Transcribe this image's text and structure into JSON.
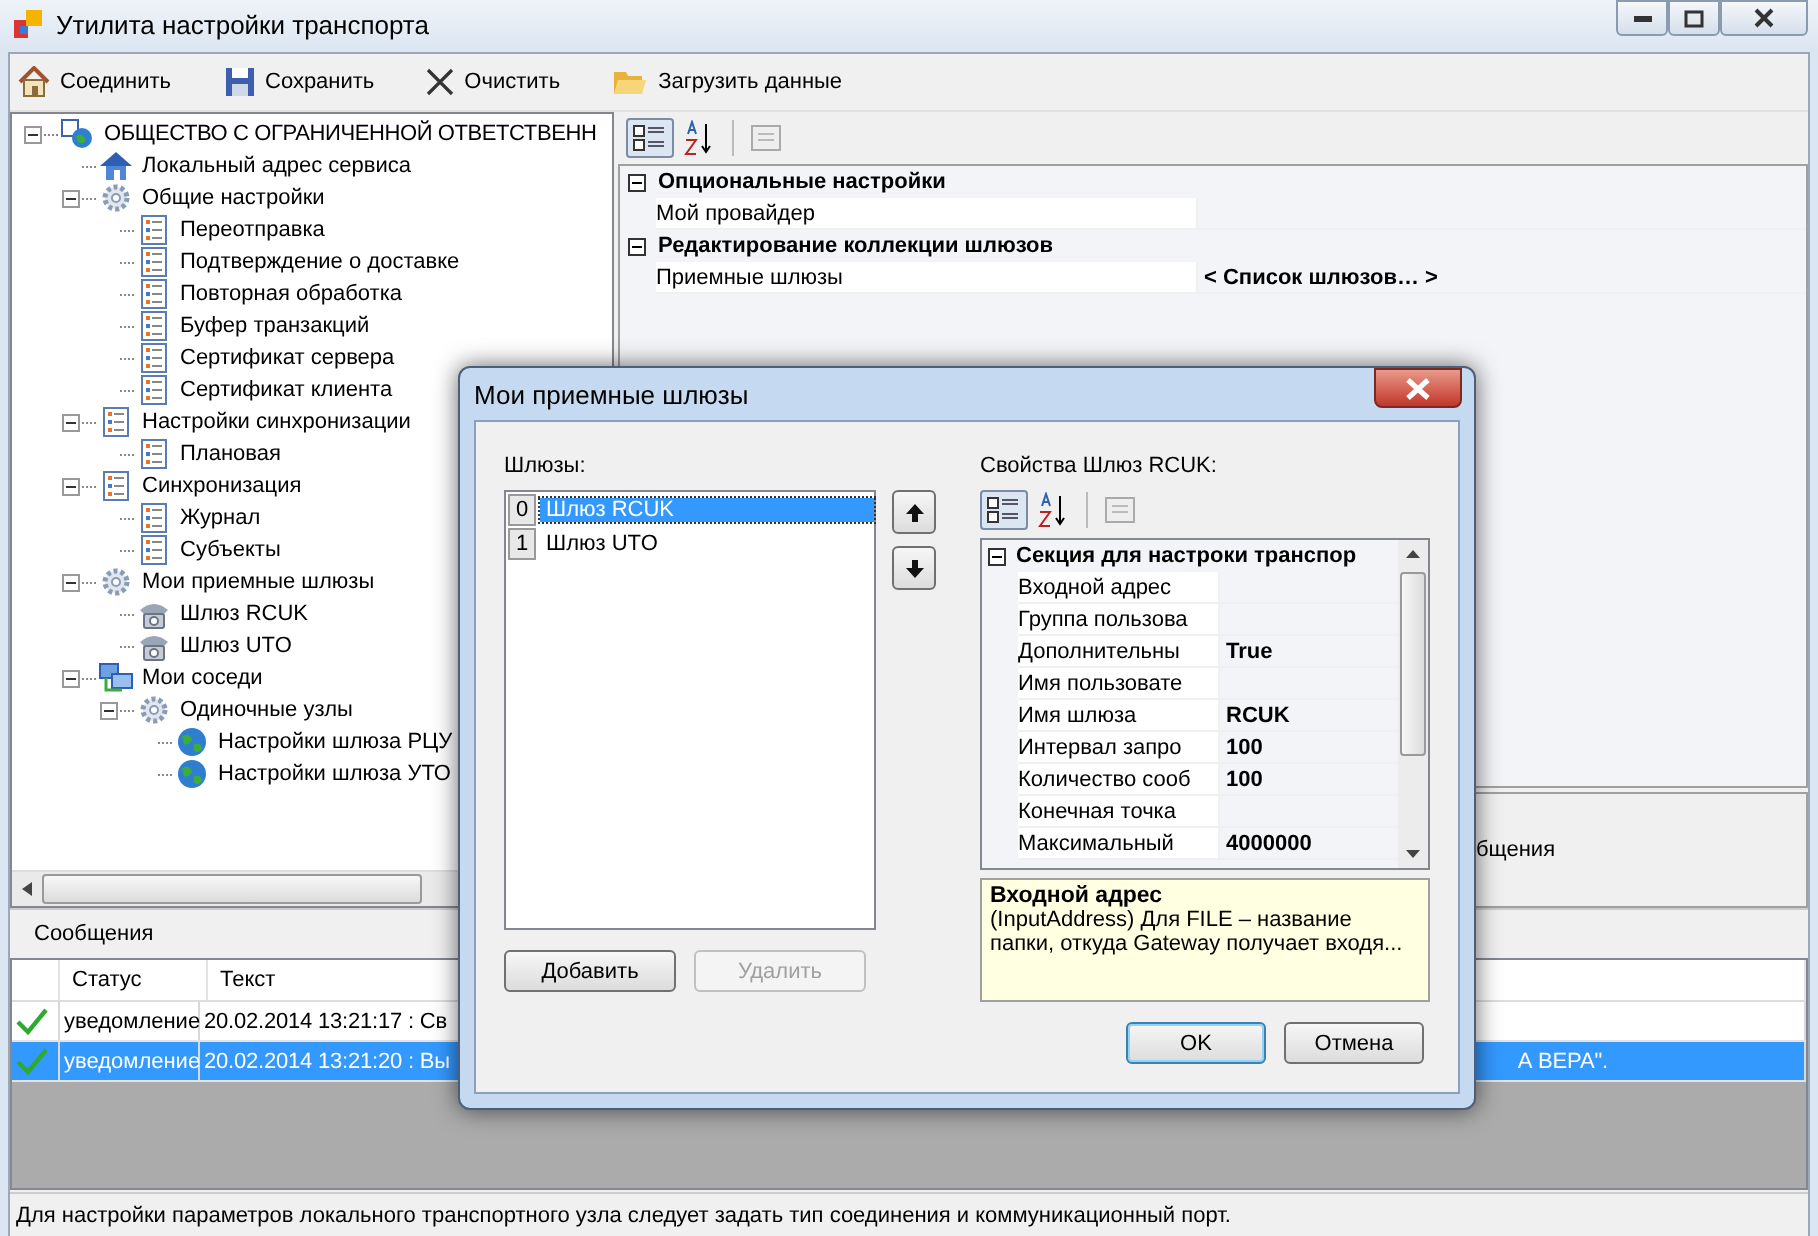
{
  "window": {
    "title": "Утилита настройки транспорта"
  },
  "toolbar": [
    {
      "label": "Соединить",
      "kind": "house"
    },
    {
      "label": "Сохранить",
      "kind": "disk"
    },
    {
      "label": "Очистить",
      "kind": "cross"
    },
    {
      "label": "Загрузить данные",
      "kind": "folder"
    }
  ],
  "tree": [
    {
      "label": "ОБЩЕСТВО С ОГРАНИЧЕННОЙ ОТВЕТСТВЕНН",
      "kind": "root",
      "expanded": true,
      "children": [
        {
          "label": "Локальный адрес сервиса",
          "kind": "house"
        },
        {
          "label": "Общие настройки",
          "kind": "gear",
          "expanded": true,
          "children": [
            {
              "label": "Переотправка",
              "kind": "list"
            },
            {
              "label": "Подтверждение о доставке",
              "kind": "list"
            },
            {
              "label": "Повторная обработка",
              "kind": "list"
            },
            {
              "label": "Буфер транзакций",
              "kind": "list"
            },
            {
              "label": "Сертификат сервера",
              "kind": "list"
            },
            {
              "label": "Сертификат клиента",
              "kind": "list"
            }
          ]
        },
        {
          "label": "Настройки синхронизации",
          "kind": "list",
          "expanded": true,
          "children": [
            {
              "label": "Плановая",
              "kind": "list"
            }
          ]
        },
        {
          "label": "Синхронизация",
          "kind": "list",
          "expanded": true,
          "children": [
            {
              "label": "Журнал",
              "kind": "list"
            },
            {
              "label": "Субъекты",
              "kind": "list"
            }
          ]
        },
        {
          "label": "Мои приемные шлюзы",
          "kind": "gear",
          "expanded": true,
          "children": [
            {
              "label": "Шлюз RCUK",
              "kind": "phone"
            },
            {
              "label": "Шлюз UTO",
              "kind": "phone"
            }
          ]
        },
        {
          "label": "Мои соседи",
          "kind": "network",
          "expanded": true,
          "children": [
            {
              "label": "Одиночные узлы",
              "kind": "gear",
              "expanded": true,
              "children": [
                {
                  "label": "Настройки шлюза РЦУ",
                  "kind": "globe"
                },
                {
                  "label": "Настройки шлюза УТО",
                  "kind": "globe"
                }
              ]
            }
          ]
        }
      ]
    }
  ],
  "property_grid": {
    "categories": [
      {
        "label": "Опциональные настройки",
        "expanded": true,
        "rows": [
          {
            "name": "Мой провайдер"
          }
        ]
      },
      {
        "label": "Редактирование коллекции шлюзов",
        "expanded": true,
        "rows": [
          {
            "name": "Приемные шлюзы",
            "value": "< Список шлюзов… >"
          }
        ]
      }
    ],
    "description": "бщения"
  },
  "messages": {
    "title": "Сообщения",
    "columns": [
      "Статус",
      "Текст"
    ],
    "rows": [
      {
        "status": "уведомление",
        "text": "20.02.2014 13:21:17 : Св",
        "selected": false
      },
      {
        "status": "уведомление",
        "text": "20.02.2014 13:21:20 : Вы",
        "text_end": "А ВЕРА\".",
        "selected": true
      }
    ]
  },
  "status_bar": "Для настройки параметров локального транспортного узла следует задать тип соединения и коммуникационный порт.",
  "dialog": {
    "title": "Мои приемные шлюзы",
    "list_label": "Шлюзы:",
    "items": [
      {
        "index": "0",
        "label": "Шлюз RCUK",
        "selected": true
      },
      {
        "index": "1",
        "label": "Шлюз UTO",
        "selected": false
      }
    ],
    "properties_label": "Свойства Шлюз RCUK:",
    "category": {
      "label": "Секция для настроки транспор",
      "expanded": true
    },
    "rows": [
      {
        "name": "Входной адрес"
      },
      {
        "name": "Группа пользова"
      },
      {
        "name": "Дополнительны",
        "value": "True"
      },
      {
        "name": "Имя пользовате"
      },
      {
        "name": "Имя шлюза",
        "value": "RCUK"
      },
      {
        "name": "Интервал запро",
        "value": "100"
      },
      {
        "name": "Количество сооб",
        "value": "100"
      },
      {
        "name": "Конечная точка"
      },
      {
        "name": "Максимальный",
        "value": "4000000"
      }
    ],
    "help_title": "Входной адрес",
    "help_text": "(InputAddress) Для FILE – название папки, откуда Gateway получает входя...",
    "buttons": [
      {
        "label": "Добавить",
        "disabled": false
      },
      {
        "label": "Удалить",
        "disabled": true
      }
    ],
    "ok": "OK",
    "cancel": "Отмена"
  }
}
